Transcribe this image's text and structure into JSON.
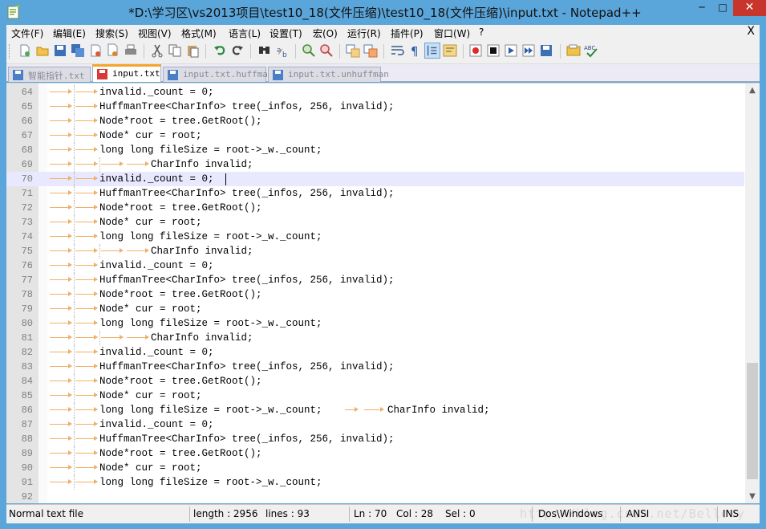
{
  "window": {
    "title": "*D:\\学习区\\vs2013项目\\test10_18(文件压缩)\\test10_18(文件压缩)\\input.txt - Notepad++",
    "minimize": "─",
    "maximize": "□",
    "close": "✕"
  },
  "menubar": {
    "items": [
      "文件(F)",
      "编辑(E)",
      "搜索(S)",
      "视图(V)",
      "格式(M)",
      "语言(L)",
      "设置(T)",
      "宏(O)",
      "运行(R)",
      "插件(P)",
      "窗口(W)",
      "?"
    ],
    "close_doc": "X"
  },
  "toolbar": {
    "icons": [
      "new-file-icon",
      "open-file-icon",
      "save-icon",
      "save-all-icon",
      "close-icon",
      "close-all-icon",
      "print-icon",
      "cut-icon",
      "copy-icon",
      "paste-icon",
      "undo-icon",
      "redo-icon",
      "find-icon",
      "replace-icon",
      "zoom-in-icon",
      "zoom-out-icon",
      "sync-vertical-icon",
      "sync-horizontal-icon",
      "word-wrap-icon",
      "show-all-chars-icon",
      "indent-guide-icon",
      "document-map-icon",
      "record-macro-icon",
      "stop-macro-icon",
      "play-macro-icon",
      "run-macro-multiple-icon",
      "save-macro-icon",
      "launch-browser-icon",
      "spell-check-icon"
    ]
  },
  "tabs": [
    {
      "label": "智能指针.txt",
      "active": false,
      "icon": "blue-save-icon"
    },
    {
      "label": "input.txt",
      "active": true,
      "icon": "red-save-icon"
    },
    {
      "label": "input.txt.huffman",
      "active": false,
      "icon": "blue-save-icon"
    },
    {
      "label": "input.txt.unhuffman",
      "active": false,
      "icon": "blue-save-icon"
    }
  ],
  "editor": {
    "current_line": 70,
    "lines": [
      {
        "n": "64",
        "tabs": 2,
        "code": "invalid._count = 0;"
      },
      {
        "n": "65",
        "tabs": 2,
        "code": "HuffmanTree<CharInfo> tree(_infos, 256, invalid);"
      },
      {
        "n": "66",
        "tabs": 2,
        "code": "Node*root = tree.GetRoot();"
      },
      {
        "n": "67",
        "tabs": 2,
        "code": "Node* cur = root;"
      },
      {
        "n": "68",
        "tabs": 2,
        "code": "long long fileSize = root->_w._count;"
      },
      {
        "n": "69",
        "tabs": 4,
        "code": "CharInfo invalid;"
      },
      {
        "n": "70",
        "tabs": 2,
        "code": "invalid._count = 0;"
      },
      {
        "n": "71",
        "tabs": 2,
        "code": "HuffmanTree<CharInfo> tree(_infos, 256, invalid);"
      },
      {
        "n": "72",
        "tabs": 2,
        "code": "Node*root = tree.GetRoot();"
      },
      {
        "n": "73",
        "tabs": 2,
        "code": "Node* cur = root;"
      },
      {
        "n": "74",
        "tabs": 2,
        "code": "long long fileSize = root->_w._count;"
      },
      {
        "n": "75",
        "tabs": 4,
        "code": "CharInfo invalid;"
      },
      {
        "n": "76",
        "tabs": 2,
        "code": "invalid._count = 0;"
      },
      {
        "n": "77",
        "tabs": 2,
        "code": "HuffmanTree<CharInfo> tree(_infos, 256, invalid);"
      },
      {
        "n": "78",
        "tabs": 2,
        "code": "Node*root = tree.GetRoot();"
      },
      {
        "n": "79",
        "tabs": 2,
        "code": "Node* cur = root;"
      },
      {
        "n": "80",
        "tabs": 2,
        "code": "long long fileSize = root->_w._count;"
      },
      {
        "n": "81",
        "tabs": 4,
        "code": "CharInfo invalid;"
      },
      {
        "n": "82",
        "tabs": 2,
        "code": "invalid._count = 0;"
      },
      {
        "n": "83",
        "tabs": 2,
        "code": "HuffmanTree<CharInfo> tree(_infos, 256, invalid);"
      },
      {
        "n": "84",
        "tabs": 2,
        "code": "Node*root = tree.GetRoot();"
      },
      {
        "n": "85",
        "tabs": 2,
        "code": "Node* cur = root;"
      },
      {
        "n": "86",
        "tabs": 2,
        "code": "long long fileSize = root->_w._count;",
        "tail": "CharInfo invalid;"
      },
      {
        "n": "87",
        "tabs": 2,
        "code": "invalid._count = 0;"
      },
      {
        "n": "88",
        "tabs": 2,
        "code": "HuffmanTree<CharInfo> tree(_infos, 256, invalid);"
      },
      {
        "n": "89",
        "tabs": 2,
        "code": "Node*root = tree.GetRoot();"
      },
      {
        "n": "90",
        "tabs": 2,
        "code": "Node* cur = root;"
      },
      {
        "n": "91",
        "tabs": 2,
        "code": "long long fileSize = root->_w._count;"
      },
      {
        "n": "92",
        "tabs": 0,
        "code": ""
      }
    ]
  },
  "statusbar": {
    "file_type": "Normal text file",
    "length": "length : 2956",
    "lines": "lines : 93",
    "ln": "Ln : 70",
    "col": "Col : 28",
    "sel": "Sel : 0",
    "eol": "Dos\\Windows",
    "encoding": "ANSI",
    "mode": "INS",
    "watermark": "http://blog.csdn.net/Bellowy"
  },
  "colors": {
    "current_line": "#e8e8ff",
    "tab_arrow": "#f0b06a",
    "active_tab_accent": "#f4a62a",
    "close_button": "#c7352c"
  }
}
